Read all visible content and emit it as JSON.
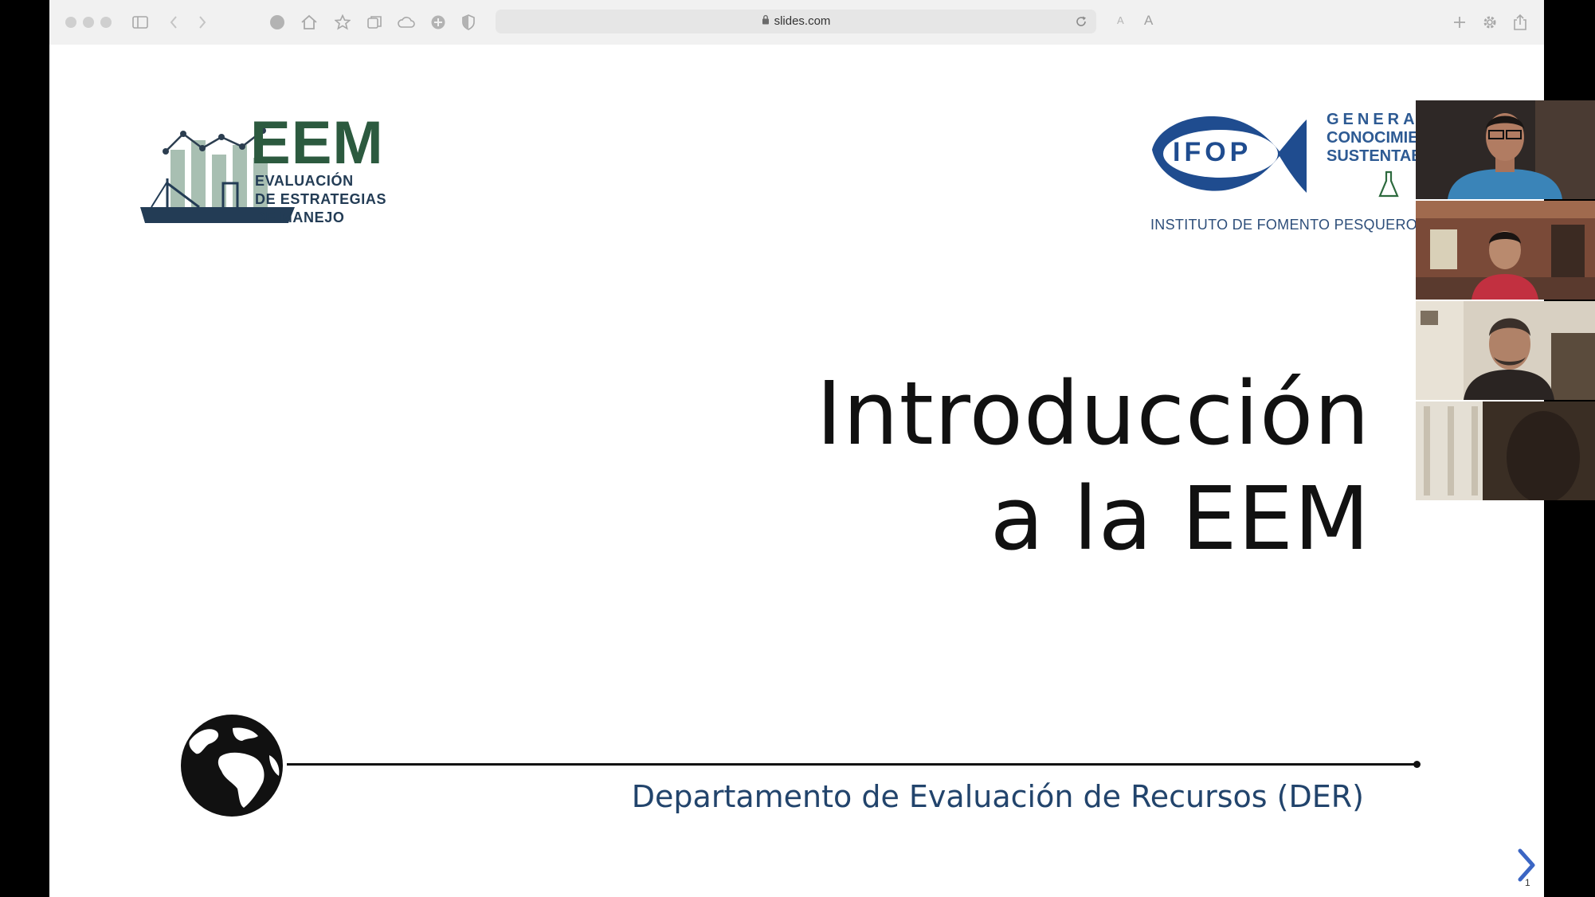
{
  "browser": {
    "url": "slides.com",
    "reader_small": "A",
    "reader_large": "A",
    "icons": [
      "sidebar-icon",
      "back-icon",
      "forward-icon",
      "globe-icon",
      "home-icon",
      "star-icon",
      "tabs-icon",
      "cloud-icon",
      "extension-icon",
      "shield-icon",
      "lock-icon",
      "reload-icon",
      "plus-icon",
      "gear-icon",
      "share-icon"
    ]
  },
  "slide": {
    "eem_logo": {
      "word": "EEM",
      "lines": [
        "EVALUACIÓN",
        "DE ESTRATEGIAS",
        "DE MANEJO"
      ]
    },
    "ifop_logo": {
      "mark": "IFOP",
      "tagline": [
        "GENERA",
        "CONOCIMIE",
        "SUSTENTAB"
      ],
      "name": "INSTITUTO DE FOMENTO PESQUERO ★"
    },
    "title": [
      "Introducción",
      "a la EEM"
    ],
    "department": "Departamento de Evaluación de Recursos (DER)",
    "page_number": "1"
  },
  "colors": {
    "eem_green": "#2c5a3f",
    "navy": "#22446c",
    "ifop_blue": "#1f4c8f",
    "next_arrow": "#3b66c4"
  },
  "video_participants": 4
}
